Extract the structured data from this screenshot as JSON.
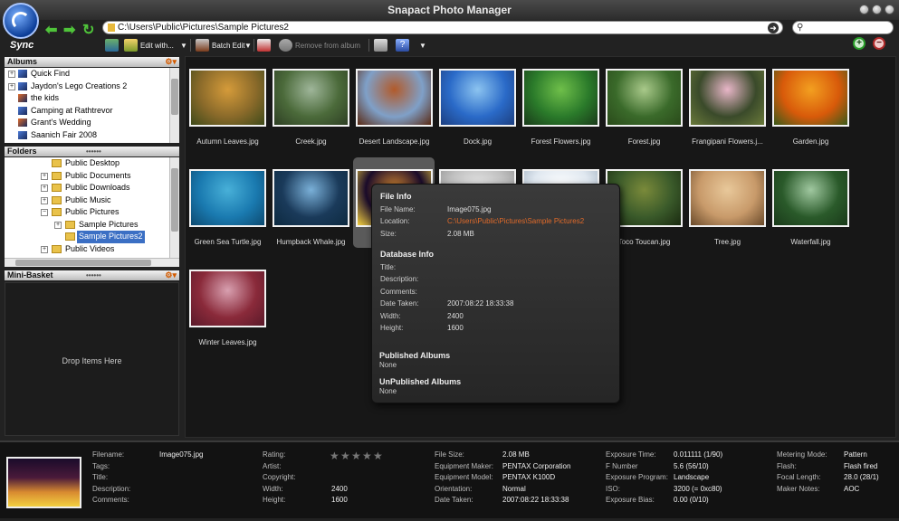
{
  "window": {
    "title": "Snapact Photo Manager"
  },
  "logo": {
    "label": "Sync"
  },
  "address": {
    "path": "C:\\Users\\Public\\Pictures\\Sample Pictures2"
  },
  "toolbar": {
    "edit_with": "Edit with...",
    "batch_edit": "Batch Edit",
    "remove_from_album": "Remove from album"
  },
  "albums": {
    "header": "Albums",
    "items": [
      {
        "label": "Quick Find",
        "expandable": true
      },
      {
        "label": "Jaydon's Lego Creations 2",
        "expandable": true
      },
      {
        "label": "the kids",
        "expandable": false
      },
      {
        "label": "Camping at Rathtrevor",
        "expandable": false
      },
      {
        "label": "Grant's Wedding",
        "expandable": false
      },
      {
        "label": "Saanich Fair 2008",
        "expandable": false
      }
    ]
  },
  "folders": {
    "header": "Folders",
    "items": [
      {
        "label": "Public Desktop",
        "level": 1,
        "expandable": false,
        "selected": false
      },
      {
        "label": "Public Documents",
        "level": 1,
        "expandable": true,
        "expanded": false,
        "selected": false
      },
      {
        "label": "Public Downloads",
        "level": 1,
        "expandable": true,
        "expanded": false,
        "selected": false
      },
      {
        "label": "Public Music",
        "level": 1,
        "expandable": true,
        "expanded": false,
        "selected": false
      },
      {
        "label": "Public Pictures",
        "level": 1,
        "expandable": true,
        "expanded": true,
        "selected": false
      },
      {
        "label": "Sample Pictures",
        "level": 2,
        "expandable": true,
        "expanded": false,
        "selected": false
      },
      {
        "label": "Sample Pictures2",
        "level": 2,
        "expandable": false,
        "selected": true
      },
      {
        "label": "Public Videos",
        "level": 1,
        "expandable": true,
        "expanded": false,
        "selected": false
      }
    ]
  },
  "mini_basket": {
    "header": "Mini-Basket",
    "drop_label": "Drop Items Here"
  },
  "gallery": {
    "thumbnails": [
      {
        "name": "Autumn Leaves.jpg",
        "colors": [
          "#8a6a2a",
          "#d59b3a",
          "#3e4a1a"
        ]
      },
      {
        "name": "Creek.jpg",
        "colors": [
          "#4b6a3a",
          "#9fb69a",
          "#2e3f24"
        ]
      },
      {
        "name": "Desert Landscape.jpg",
        "colors": [
          "#7fa0c8",
          "#b25a2a",
          "#5a2a14"
        ]
      },
      {
        "name": "Dock.jpg",
        "colors": [
          "#2a6ac8",
          "#8cc4f0",
          "#1d3f80"
        ]
      },
      {
        "name": "Forest Flowers.jpg",
        "colors": [
          "#2a7a2a",
          "#6fbf4a",
          "#1a3a1a"
        ]
      },
      {
        "name": "Forest.jpg",
        "colors": [
          "#3a6a2a",
          "#a9c98a",
          "#2a4a1a"
        ]
      },
      {
        "name": "Frangipani Flowers.j...",
        "colors": [
          "#3a4a2a",
          "#e8b6c8",
          "#6a7a3a"
        ]
      },
      {
        "name": "Garden.jpg",
        "colors": [
          "#d85a0a",
          "#f3a020",
          "#3a5a1a"
        ]
      },
      {
        "name": "Green Sea Turtle.jpg",
        "colors": [
          "#1a7ab0",
          "#48b0d8",
          "#0d4a70"
        ]
      },
      {
        "name": "Humpback Whale.jpg",
        "colors": [
          "#1a3a5a",
          "#7ab0d8",
          "#0d2a40"
        ]
      },
      {
        "name": "Image075.jpg",
        "colors": [
          "#1a0b2a",
          "#d88a30",
          "#f3d040"
        ]
      },
      {
        "name": "",
        "colors": [
          "#c0c0c0",
          "#e8e8e8",
          "#909090"
        ]
      },
      {
        "name": "",
        "colors": [
          "#e0e8f0",
          "#ffffff",
          "#a0b0c0"
        ]
      },
      {
        "name": "Toco Toucan.jpg",
        "colors": [
          "#3a5a2a",
          "#7a8a3a",
          "#1a2a10"
        ]
      },
      {
        "name": "Tree.jpg",
        "colors": [
          "#c89a6a",
          "#e8c89a",
          "#6a4a2a"
        ]
      },
      {
        "name": "Waterfall.jpg",
        "colors": [
          "#2a5a2a",
          "#a0c8a0",
          "#1a3a1a"
        ]
      },
      {
        "name": "Winter Leaves.jpg",
        "colors": [
          "#8a2a3a",
          "#d8a0b0",
          "#5a1a2a"
        ]
      }
    ]
  },
  "info_popup": {
    "file_info": {
      "heading": "File Info",
      "rows": [
        {
          "key": "File Name:",
          "value": "Image075.jpg"
        },
        {
          "key": "Location:",
          "value": "C:\\Users\\Public\\Pictures\\Sample Pictures2"
        },
        {
          "key": "Size:",
          "value": "2.08 MB"
        }
      ]
    },
    "database_info": {
      "heading": "Database Info",
      "rows": [
        {
          "key": "Title:",
          "value": ""
        },
        {
          "key": "Description:",
          "value": ""
        },
        {
          "key": "Comments:",
          "value": ""
        },
        {
          "key": "Date Taken:",
          "value": "2007:08:22 18:33:38"
        },
        {
          "key": "Width:",
          "value": "2400"
        },
        {
          "key": "Height:",
          "value": "1600"
        }
      ]
    },
    "published": {
      "heading": "Published Albums",
      "value": "None"
    },
    "unpublished": {
      "heading": "UnPublished Albums",
      "value": "None"
    }
  },
  "details": {
    "col1": [
      {
        "key": "Filename:",
        "value": "Image075.jpg"
      },
      {
        "key": "Tags:",
        "value": ""
      },
      {
        "key": "Title:",
        "value": ""
      },
      {
        "key": "Description:",
        "value": ""
      },
      {
        "key": "Comments:",
        "value": ""
      }
    ],
    "col2": [
      {
        "key": "Rating:",
        "value": ""
      },
      {
        "key": "Artist:",
        "value": ""
      },
      {
        "key": "Copyright:",
        "value": ""
      },
      {
        "key": "Width:",
        "value": "2400"
      },
      {
        "key": "Height:",
        "value": "1600"
      }
    ],
    "col3": [
      {
        "key": "File Size:",
        "value": "2.08 MB"
      },
      {
        "key": "Equipment Maker:",
        "value": "PENTAX Corporation"
      },
      {
        "key": "Equipment Model:",
        "value": "PENTAX K100D"
      },
      {
        "key": "Orientation:",
        "value": "Normal"
      },
      {
        "key": "Date Taken:",
        "value": "2007:08:22 18:33:38"
      }
    ],
    "col4": [
      {
        "key": "Exposure Time:",
        "value": "0.011111 (1/90)"
      },
      {
        "key": "F Number",
        "value": "5.6 (56/10)"
      },
      {
        "key": "Exposure Program:",
        "value": "Landscape"
      },
      {
        "key": "ISO:",
        "value": "3200 (= 0xc80)"
      },
      {
        "key": "Exposure Bias:",
        "value": "0.00 (0/10)"
      }
    ],
    "col5": [
      {
        "key": "Metering Mode:",
        "value": "Pattern"
      },
      {
        "key": "Flash:",
        "value": "Flash fired"
      },
      {
        "key": "Focal Length:",
        "value": "28.0 (28/1)"
      },
      {
        "key": "Maker Notes:",
        "value": "AOC"
      }
    ],
    "rating_stars": 0,
    "rating_max": 5
  }
}
